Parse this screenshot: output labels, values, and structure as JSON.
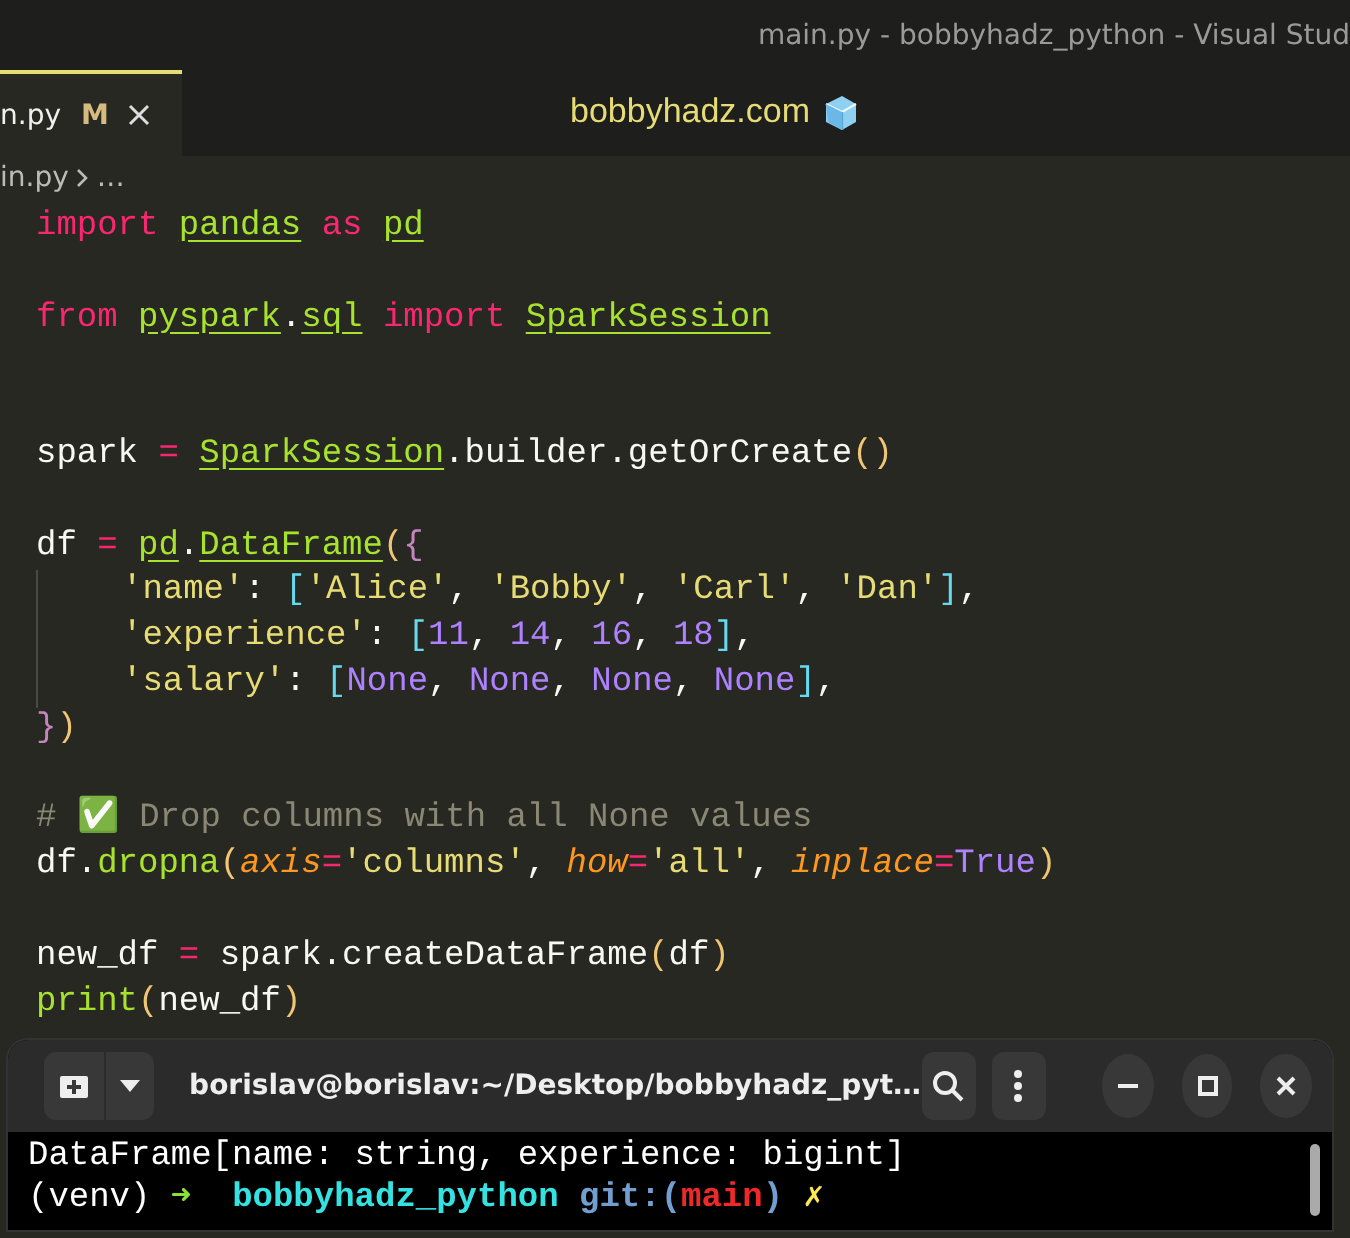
{
  "window": {
    "title": "main.py - bobbyhadz_python - Visual Stud"
  },
  "tabs": [
    {
      "label": "n.py",
      "badge": "M",
      "selected": true
    }
  ],
  "banner": {
    "text": "bobbyhadz.com"
  },
  "breadcrumb": [
    "in.py",
    "…"
  ],
  "code_lines": [
    {
      "tokens": [
        {
          "kind": "kw",
          "t": "import "
        },
        {
          "kind": "mod",
          "t": "pandas"
        },
        {
          "kind": "kw",
          "t": " as "
        },
        {
          "kind": "mod",
          "t": "pd"
        }
      ]
    },
    {
      "blank": true
    },
    {
      "tokens": [
        {
          "kind": "kw",
          "t": "from "
        },
        {
          "kind": "mod",
          "t": "pyspark"
        },
        {
          "kind": "p",
          "t": "."
        },
        {
          "kind": "mod",
          "t": "sql"
        },
        {
          "kind": "kw",
          "t": " import "
        },
        {
          "kind": "mod",
          "t": "SparkSession"
        }
      ]
    },
    {
      "blank": true
    },
    {
      "blank": true
    },
    {
      "tokens": [
        {
          "kind": "p",
          "t": "spark "
        },
        {
          "kind": "kw",
          "t": "= "
        },
        {
          "kind": "mod",
          "t": "SparkSession"
        },
        {
          "kind": "p",
          "t": ".builder.getOrCreate"
        },
        {
          "kind": "paren",
          "t": "()"
        }
      ]
    },
    {
      "blank": true
    },
    {
      "tokens": [
        {
          "kind": "p",
          "t": "df "
        },
        {
          "kind": "kw",
          "t": "= "
        },
        {
          "kind": "mod",
          "t": "pd"
        },
        {
          "kind": "p",
          "t": "."
        },
        {
          "kind": "mod",
          "t": "DataFrame"
        },
        {
          "kind": "paren",
          "t": "("
        },
        {
          "kind": "brace",
          "t": "{"
        }
      ]
    },
    {
      "indented": true,
      "tokens": [
        {
          "kind": "str",
          "t": "'name'"
        },
        {
          "kind": "p",
          "t": ": "
        },
        {
          "kind": "bracket",
          "t": "["
        },
        {
          "kind": "str",
          "t": "'Alice'"
        },
        {
          "kind": "p",
          "t": ", "
        },
        {
          "kind": "str",
          "t": "'Bobby'"
        },
        {
          "kind": "p",
          "t": ", "
        },
        {
          "kind": "str",
          "t": "'Carl'"
        },
        {
          "kind": "p",
          "t": ", "
        },
        {
          "kind": "str",
          "t": "'Dan'"
        },
        {
          "kind": "bracket",
          "t": "]"
        },
        {
          "kind": "p",
          "t": ","
        }
      ]
    },
    {
      "indented": true,
      "tokens": [
        {
          "kind": "str",
          "t": "'experience'"
        },
        {
          "kind": "p",
          "t": ": "
        },
        {
          "kind": "bracket",
          "t": "["
        },
        {
          "kind": "num",
          "t": "11"
        },
        {
          "kind": "p",
          "t": ", "
        },
        {
          "kind": "num",
          "t": "14"
        },
        {
          "kind": "p",
          "t": ", "
        },
        {
          "kind": "num",
          "t": "16"
        },
        {
          "kind": "p",
          "t": ", "
        },
        {
          "kind": "num",
          "t": "18"
        },
        {
          "kind": "bracket",
          "t": "]"
        },
        {
          "kind": "p",
          "t": ","
        }
      ]
    },
    {
      "indented": true,
      "tokens": [
        {
          "kind": "str",
          "t": "'salary'"
        },
        {
          "kind": "p",
          "t": ": "
        },
        {
          "kind": "bracket",
          "t": "["
        },
        {
          "kind": "num",
          "t": "None"
        },
        {
          "kind": "p",
          "t": ", "
        },
        {
          "kind": "num",
          "t": "None"
        },
        {
          "kind": "p",
          "t": ", "
        },
        {
          "kind": "num",
          "t": "None"
        },
        {
          "kind": "p",
          "t": ", "
        },
        {
          "kind": "num",
          "t": "None"
        },
        {
          "kind": "bracket",
          "t": "]"
        },
        {
          "kind": "p",
          "t": ","
        }
      ]
    },
    {
      "tokens": [
        {
          "kind": "brace",
          "t": "}"
        },
        {
          "kind": "paren",
          "t": ")"
        }
      ]
    },
    {
      "blank": true
    },
    {
      "tokens": [
        {
          "kind": "comment",
          "t": "# ✅ Drop columns with all None values"
        }
      ]
    },
    {
      "tokens": [
        {
          "kind": "p",
          "t": "df."
        },
        {
          "kind": "func",
          "t": "dropna"
        },
        {
          "kind": "paren",
          "t": "("
        },
        {
          "kind": "param",
          "t": "axis"
        },
        {
          "kind": "kw",
          "t": "="
        },
        {
          "kind": "str",
          "t": "'columns'"
        },
        {
          "kind": "p",
          "t": ", "
        },
        {
          "kind": "param",
          "t": "how"
        },
        {
          "kind": "kw",
          "t": "="
        },
        {
          "kind": "str",
          "t": "'all'"
        },
        {
          "kind": "p",
          "t": ", "
        },
        {
          "kind": "param",
          "t": "inplace"
        },
        {
          "kind": "kw",
          "t": "="
        },
        {
          "kind": "num",
          "t": "True"
        },
        {
          "kind": "paren",
          "t": ")"
        }
      ]
    },
    {
      "blank": true
    },
    {
      "tokens": [
        {
          "kind": "p",
          "t": "new_df "
        },
        {
          "kind": "kw",
          "t": "="
        },
        {
          "kind": "p",
          "t": " spark.createDataFrame"
        },
        {
          "kind": "paren",
          "t": "("
        },
        {
          "kind": "p",
          "t": "df"
        },
        {
          "kind": "paren",
          "t": ")"
        }
      ]
    },
    {
      "tokens": [
        {
          "kind": "func",
          "t": "print"
        },
        {
          "kind": "paren",
          "t": "("
        },
        {
          "kind": "p",
          "t": "new_df"
        },
        {
          "kind": "paren",
          "t": ")"
        }
      ]
    }
  ],
  "terminal": {
    "title": "borislav@borislav:~/Desktop/bobbyhadz_pyt…",
    "output": [
      "DataFrame[name: string, experience: bigint]"
    ],
    "prompt": [
      {
        "kind": "plain",
        "t": "(venv) "
      },
      {
        "kind": "arrow",
        "t": "➜"
      },
      {
        "kind": "dir",
        "t": "  bobbyhadz_python"
      },
      {
        "kind": "git",
        "t": " git:("
      },
      {
        "kind": "branch",
        "t": "main"
      },
      {
        "kind": "git",
        "t": ")"
      },
      {
        "kind": "dirty",
        "t": " ✗"
      }
    ]
  }
}
